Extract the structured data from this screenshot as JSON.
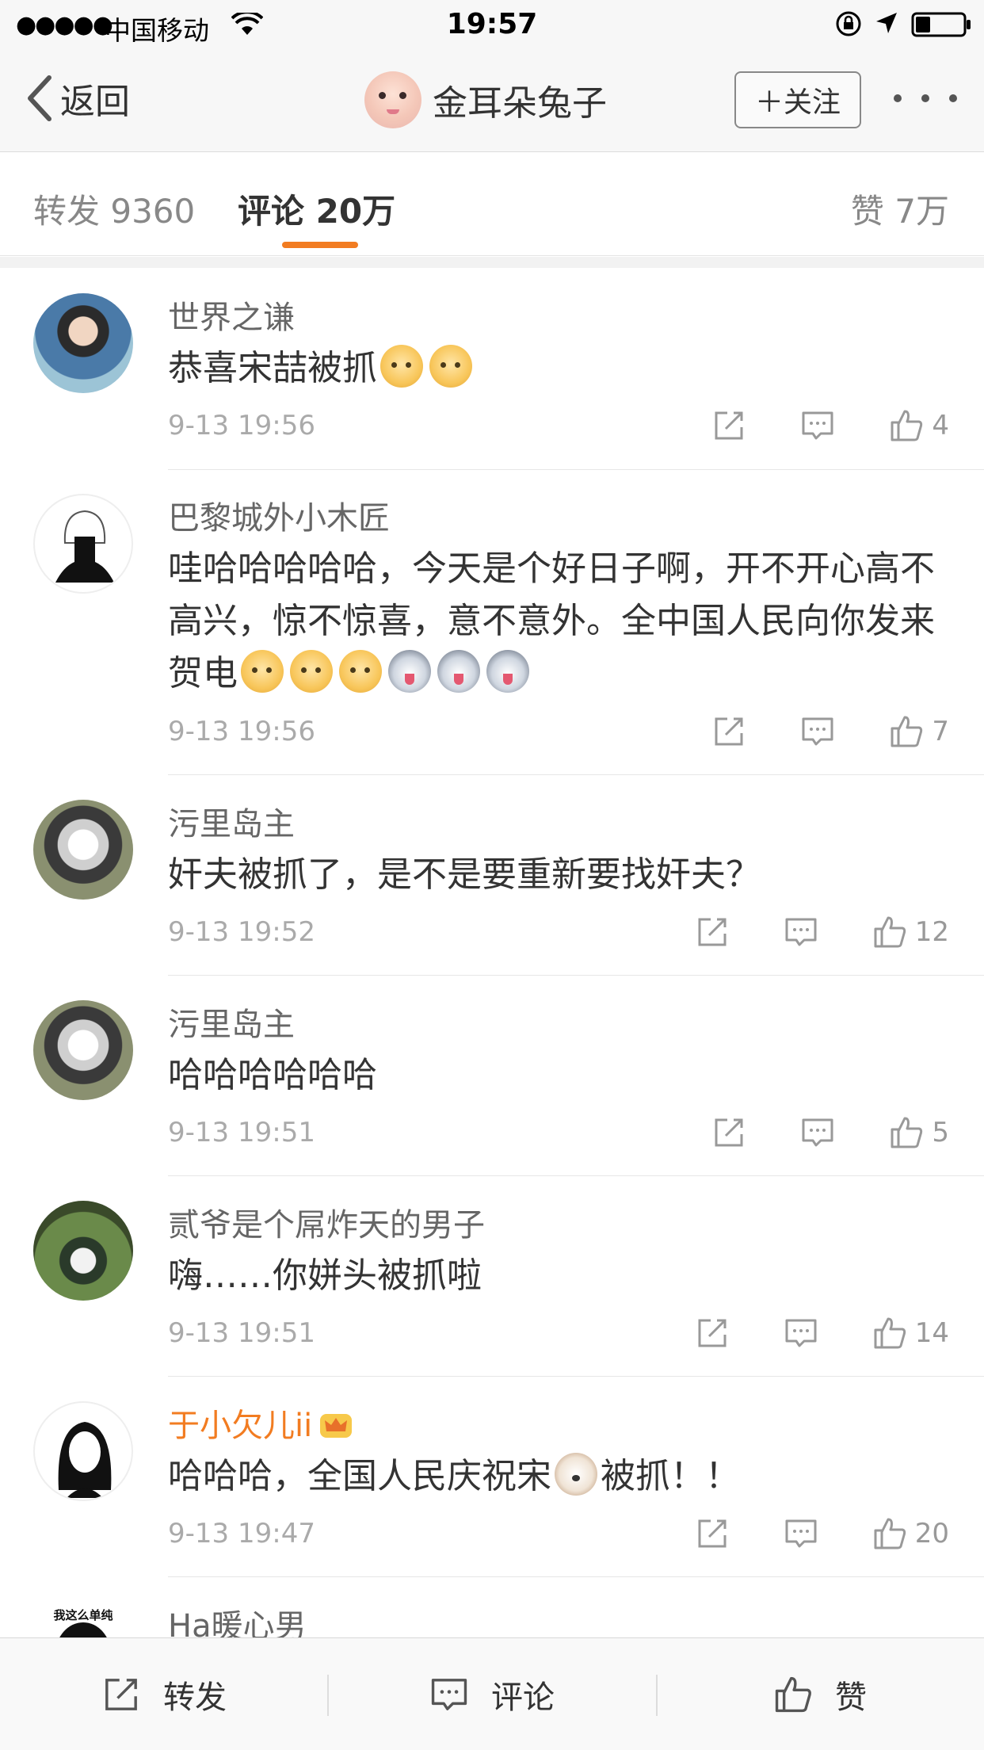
{
  "status_bar": {
    "signal": "●●●●●",
    "carrier": "中国移动",
    "time": "19:57"
  },
  "nav": {
    "back_label": "返回",
    "title": "金耳朵兔子",
    "follow_label": "＋关注",
    "more_icon": "more-dots-icon"
  },
  "tabs": {
    "repost": "转发 9360",
    "comment": "评论 20万",
    "like": "赞 7万",
    "active": "comment",
    "accent_color": "#f27c21"
  },
  "comments": [
    {
      "name": "世界之谦",
      "text": "恭喜宋喆被抓",
      "emojis": [
        "doge",
        "doge"
      ],
      "time": "9-13 19:56",
      "likes": "4"
    },
    {
      "name": "巴黎城外小木匠",
      "text": "哇哈哈哈哈哈，今天是个好日子啊，开不开心高不高兴，惊不惊喜，意不意外。全中国人民向你发来贺电",
      "emojis": [
        "doge",
        "doge",
        "doge",
        "husky",
        "husky",
        "husky"
      ],
      "time": "9-13 19:56",
      "likes": "7"
    },
    {
      "name": "污里岛主",
      "text": "奸夫被抓了，是不是要重新要找奸夫？",
      "time": "9-13 19:52",
      "likes": "12"
    },
    {
      "name": "污里岛主",
      "text": "哈哈哈哈哈哈",
      "time": "9-13 19:51",
      "likes": "5"
    },
    {
      "name": "贰爷是个屌炸天的男子",
      "text": "嗨……你姘头被抓啦",
      "time": "9-13 19:51",
      "likes": "14"
    },
    {
      "name": "于小欠儿ii",
      "vip": true,
      "text_before": "哈哈哈，全国人民庆祝宋",
      "emoji": "dog",
      "text_after": "被抓！！",
      "time": "9-13 19:47",
      "likes": "20"
    },
    {
      "name": "Ha暖心男",
      "avatar_text": "我这么单纯"
    }
  ],
  "toolbar": {
    "repost": "转发",
    "comment": "评论",
    "like": "赞"
  }
}
